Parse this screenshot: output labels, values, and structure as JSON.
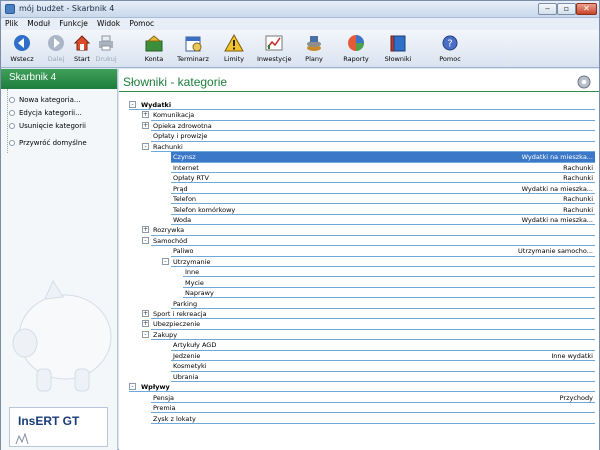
{
  "window": {
    "title": "mój budżet - Skarbnik 4"
  },
  "menu": [
    "Plik",
    "Moduł",
    "Funkcje",
    "Widok",
    "Pomoc"
  ],
  "toolbar": {
    "back": "Wstecz",
    "fwd": "Dalej",
    "start": "Start",
    "print": "Drukuj",
    "modules": [
      "Konta",
      "Terminarz",
      "Limity",
      "Inwestycje",
      "Plany",
      "Raporty",
      "Słowniki"
    ],
    "help": "Pomoc"
  },
  "sidebar": {
    "header": "Skarbnik 4",
    "items": [
      "Nowa kategoria...",
      "Edycja kategorii...",
      "Usunięcie kategorii",
      "Przywróć domyślne"
    ],
    "logo": "InsERT GT"
  },
  "main": {
    "title": "Słowniki - kategorie",
    "rows": [
      {
        "level": 0,
        "exp": "-",
        "name": "Wydatki",
        "value": "",
        "bold": true
      },
      {
        "level": 1,
        "exp": "+",
        "name": "Komunikacja",
        "value": ""
      },
      {
        "level": 1,
        "exp": "+",
        "name": "Opieka zdrowotna",
        "value": ""
      },
      {
        "level": 1,
        "exp": "",
        "name": "Opłaty i prowizje",
        "value": ""
      },
      {
        "level": 1,
        "exp": "-",
        "name": "Rachunki",
        "value": ""
      },
      {
        "level": 2,
        "exp": "",
        "name": "Czynsz",
        "value": "Wydatki na mieszka...",
        "selected": true
      },
      {
        "level": 2,
        "exp": "",
        "name": "Internet",
        "value": "Rachunki"
      },
      {
        "level": 2,
        "exp": "",
        "name": "Opłaty RTV",
        "value": "Rachunki"
      },
      {
        "level": 2,
        "exp": "",
        "name": "Prąd",
        "value": "Wydatki na mieszka..."
      },
      {
        "level": 2,
        "exp": "",
        "name": "Telefon",
        "value": "Rachunki"
      },
      {
        "level": 2,
        "exp": "",
        "name": "Telefon komórkowy",
        "value": "Rachunki"
      },
      {
        "level": 2,
        "exp": "",
        "name": "Woda",
        "value": "Wydatki na mieszka..."
      },
      {
        "level": 1,
        "exp": "+",
        "name": "Rozrywka",
        "value": ""
      },
      {
        "level": 1,
        "exp": "-",
        "name": "Samochód",
        "value": ""
      },
      {
        "level": 2,
        "exp": "",
        "name": "Paliwo",
        "value": "Utrzymanie samocho..."
      },
      {
        "level": 2,
        "exp": "-",
        "name": "Utrzymanie",
        "value": ""
      },
      {
        "level": 3,
        "exp": "",
        "name": "Inne",
        "value": ""
      },
      {
        "level": 3,
        "exp": "",
        "name": "Mycie",
        "value": ""
      },
      {
        "level": 3,
        "exp": "",
        "name": "Naprawy",
        "value": ""
      },
      {
        "level": 2,
        "exp": "",
        "name": "Parking",
        "value": ""
      },
      {
        "level": 1,
        "exp": "+",
        "name": "Sport i rekreacja",
        "value": ""
      },
      {
        "level": 1,
        "exp": "+",
        "name": "Ubezpieczenie",
        "value": ""
      },
      {
        "level": 1,
        "exp": "-",
        "name": "Zakupy",
        "value": ""
      },
      {
        "level": 2,
        "exp": "",
        "name": "Artykuły AGD",
        "value": ""
      },
      {
        "level": 2,
        "exp": "",
        "name": "Jedzenie",
        "value": "Inne wydatki"
      },
      {
        "level": 2,
        "exp": "",
        "name": "Kosmetyki",
        "value": ""
      },
      {
        "level": 2,
        "exp": "",
        "name": "Ubrania",
        "value": ""
      },
      {
        "level": 0,
        "exp": "-",
        "name": "Wpływy",
        "value": "",
        "bold": true
      },
      {
        "level": 1,
        "exp": "",
        "name": "Pensja",
        "value": "Przychody"
      },
      {
        "level": 1,
        "exp": "",
        "name": "Premia",
        "value": ""
      },
      {
        "level": 1,
        "exp": "",
        "name": "Zysk z lokaty",
        "value": ""
      }
    ]
  }
}
